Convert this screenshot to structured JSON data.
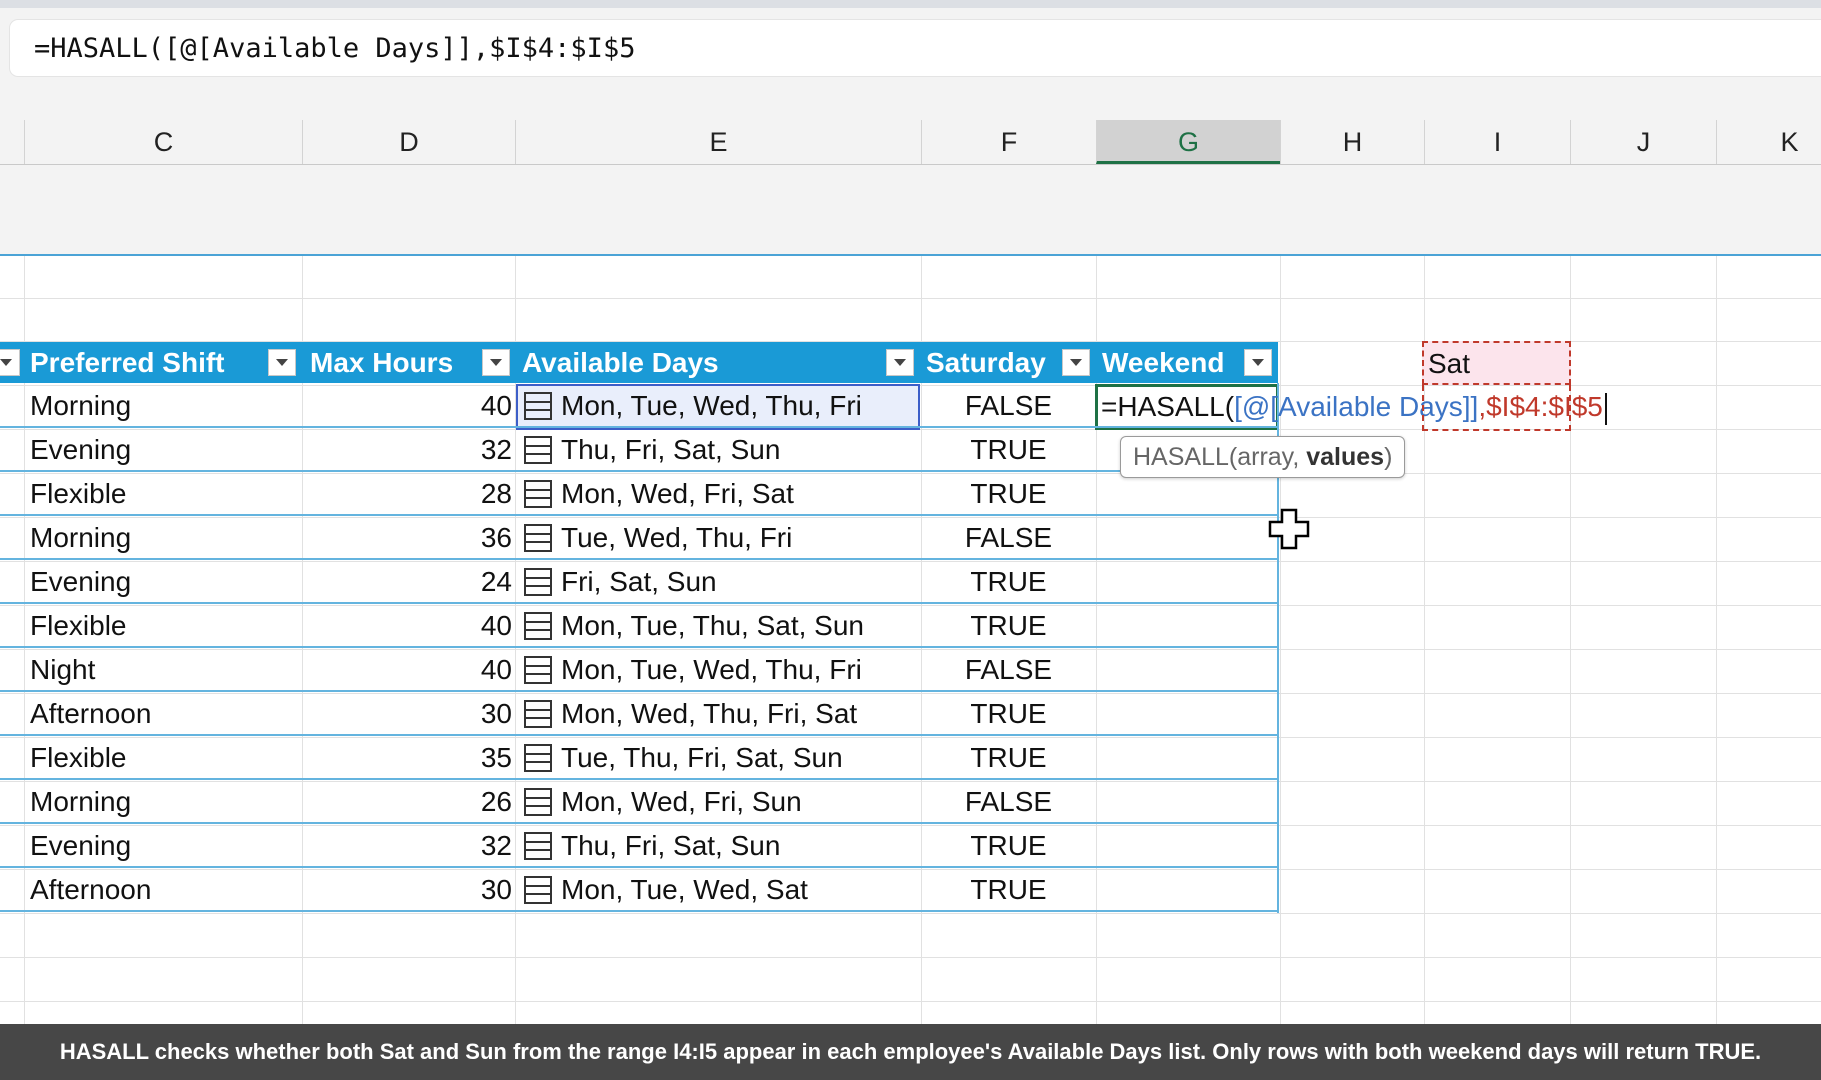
{
  "formula_bar": {
    "text": "=HASALL([@[Available Days]],$I$4:$I$5"
  },
  "columns": [
    "C",
    "D",
    "E",
    "F",
    "G",
    "H",
    "I",
    "J",
    "K"
  ],
  "selected_column": "G",
  "table": {
    "headers": {
      "preferred_shift": "Preferred Shift",
      "max_hours": "Max Hours",
      "available_days": "Available Days",
      "saturday": "Saturday",
      "weekend": "Weekend"
    },
    "rows": [
      {
        "shift": "Morning",
        "hours": "40",
        "days": "Mon, Tue, Wed, Thu, Fri",
        "saturday": "FALSE"
      },
      {
        "shift": "Evening",
        "hours": "32",
        "days": "Thu, Fri, Sat, Sun",
        "saturday": "TRUE"
      },
      {
        "shift": "Flexible",
        "hours": "28",
        "days": "Mon, Wed, Fri, Sat",
        "saturday": "TRUE"
      },
      {
        "shift": "Morning",
        "hours": "36",
        "days": "Tue, Wed, Thu, Fri",
        "saturday": "FALSE"
      },
      {
        "shift": "Evening",
        "hours": "24",
        "days": "Fri, Sat, Sun",
        "saturday": "TRUE"
      },
      {
        "shift": "Flexible",
        "hours": "40",
        "days": "Mon, Tue, Thu, Sat, Sun",
        "saturday": "TRUE"
      },
      {
        "shift": "Night",
        "hours": "40",
        "days": "Mon, Tue, Wed, Thu, Fri",
        "saturday": "FALSE"
      },
      {
        "shift": "Afternoon",
        "hours": "30",
        "days": "Mon, Wed, Thu, Fri, Sat",
        "saturday": "TRUE"
      },
      {
        "shift": "Flexible",
        "hours": "35",
        "days": "Tue, Thu, Fri, Sat, Sun",
        "saturday": "TRUE"
      },
      {
        "shift": "Morning",
        "hours": "26",
        "days": "Mon, Wed, Fri, Sun",
        "saturday": "FALSE"
      },
      {
        "shift": "Evening",
        "hours": "32",
        "days": "Thu, Fri, Sat, Sun",
        "saturday": "TRUE"
      },
      {
        "shift": "Afternoon",
        "hours": "30",
        "days": "Mon, Tue, Wed, Sat",
        "saturday": "TRUE"
      }
    ]
  },
  "lookup_cell": {
    "value": "Sat"
  },
  "in_cell_formula": {
    "prefix": "=HASALL(",
    "arg1": "[@[Available Days]]",
    "sep": ",",
    "arg2": "$I$4:$I$5"
  },
  "tooltip": {
    "func": "HASALL(",
    "arg_array": "array, ",
    "arg_values": "values",
    "close": ")"
  },
  "caption": "HASALL checks whether both Sat and Sun from the range I4:I5 appear in each employee's Available Days list. Only rows with both weekend days will return TRUE.",
  "colors": {
    "table_header": "#1a9ad6",
    "active_cell_border": "#1e7145",
    "arg1_color": "#3b73c4",
    "arg2_color": "#c0392b"
  }
}
